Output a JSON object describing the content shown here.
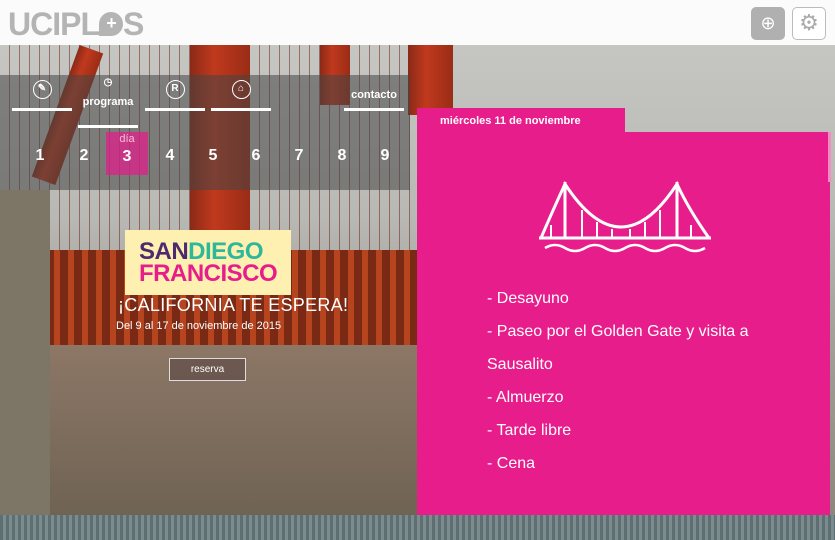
{
  "header": {
    "logo": "UCIPLUS",
    "logo_plus": "+",
    "icons": [
      "add-window-icon",
      "settings-gear-icon"
    ]
  },
  "nav": {
    "items": [
      {
        "label": "",
        "icon": "compass-icon"
      },
      {
        "label": "programa",
        "icon": "clock-icon"
      },
      {
        "label": "",
        "icon": "r-icon"
      },
      {
        "label": "",
        "icon": "building-icon"
      },
      {
        "label": "contacto",
        "icon": ""
      }
    ],
    "day_label": "día",
    "days": [
      "1",
      "2",
      "3",
      "4",
      "5",
      "6",
      "7",
      "8",
      "9"
    ],
    "active_day": "3"
  },
  "promo": {
    "san": "SAN",
    "diego": "DIEGO",
    "francisco": "FRANCISCO",
    "tagline": "¡CALIFORNIA TE ESPERA!",
    "dates": "Del 9 al 17 de noviembre de 2015",
    "button": "reserva"
  },
  "panel": {
    "tab": "miércoles 11 de noviembre",
    "icon": "golden-gate-bridge-icon",
    "items": [
      "- Desayuno",
      "- Paseo por el Golden Gate y visita a Sausalito",
      "- Almuerzo",
      "- Tarde libre",
      "- Cena"
    ]
  },
  "colors": {
    "accent": "#e81d8c",
    "promo_bg": "#fdf0b0",
    "purple": "#4d2a6f",
    "teal": "#2fb79a"
  }
}
